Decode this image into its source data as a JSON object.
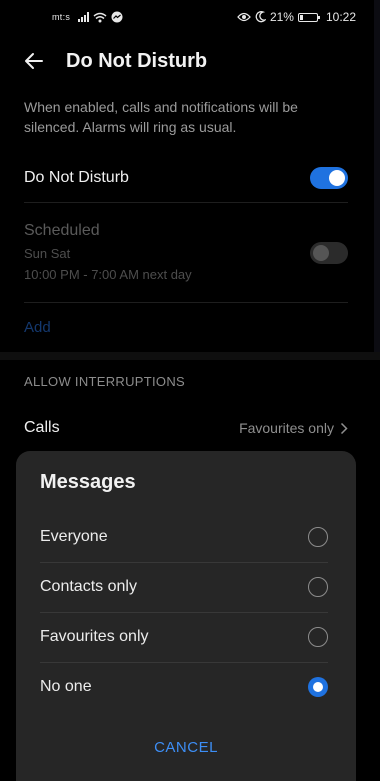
{
  "status_bar": {
    "carrier": "mt:s",
    "battery": "21%",
    "battery_level": 0.21,
    "time": "10:22",
    "icons": [
      "signal-icon",
      "wifi-icon",
      "messenger-icon",
      "eye-icon",
      "moon-icon",
      "battery-icon"
    ]
  },
  "app_bar": {
    "title": "Do Not Disturb",
    "back_icon": "arrow-left-icon"
  },
  "description": "When enabled, calls and notifications will be silenced. Alarms will ring as usual.",
  "dnd_toggle": {
    "label": "Do Not Disturb",
    "on": true
  },
  "scheduled": {
    "title": "Scheduled",
    "days": "Sun Sat",
    "time": "10:00 PM - 7:00 AM next day",
    "on": false
  },
  "add_label": "Add",
  "section_header": "ALLOW INTERRUPTIONS",
  "calls": {
    "label": "Calls",
    "value": "Favourites only"
  },
  "sheet": {
    "title": "Messages",
    "options": [
      {
        "label": "Everyone",
        "selected": false
      },
      {
        "label": "Contacts only",
        "selected": false
      },
      {
        "label": "Favourites only",
        "selected": false
      },
      {
        "label": "No one",
        "selected": true
      }
    ],
    "cancel_label": "CANCEL"
  },
  "colors": {
    "accent": "#1f72e0",
    "link": "#3d8ef5",
    "background": "#000000",
    "sheet": "#262626"
  }
}
